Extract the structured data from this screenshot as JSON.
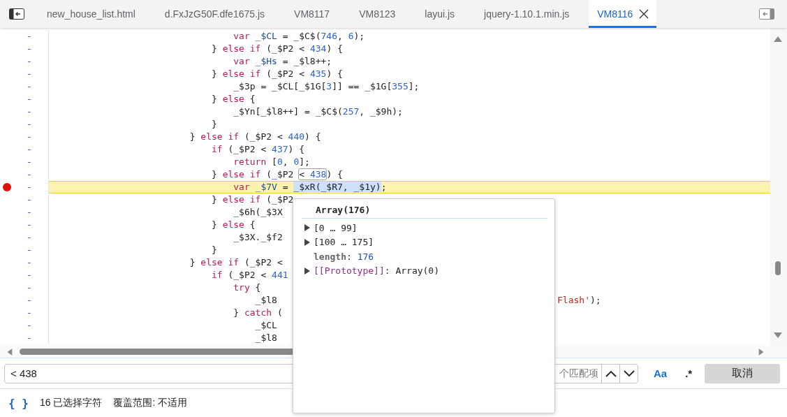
{
  "tabs": [
    {
      "label": "new_house_list.html",
      "selected": false
    },
    {
      "label": "d.FxJzG50F.dfe1675.js",
      "selected": false
    },
    {
      "label": "VM8117",
      "selected": false
    },
    {
      "label": "VM8123",
      "selected": false
    },
    {
      "label": "layui.js",
      "selected": false
    },
    {
      "label": "jquery-1.10.1.min.js",
      "selected": false
    },
    {
      "label": "VM8116",
      "selected": true
    }
  ],
  "lines": [
    {
      "gutter": "-",
      "breakpoint": false,
      "current": false,
      "tokens": [
        {
          "kind": "kw",
          "text": "                                 var"
        },
        {
          "kind": "def",
          "text": " _$CL"
        },
        {
          "kind": "plain",
          "text": " = _$C$("
        },
        {
          "kind": "num",
          "text": "746"
        },
        {
          "kind": "plain",
          "text": ", "
        },
        {
          "kind": "num",
          "text": "6"
        },
        {
          "kind": "plain",
          "text": ");"
        }
      ]
    },
    {
      "gutter": "-",
      "breakpoint": false,
      "current": false,
      "tokens": [
        {
          "kind": "plain",
          "text": "                             } "
        },
        {
          "kind": "kw",
          "text": "else if"
        },
        {
          "kind": "plain",
          "text": " (_$P2 < "
        },
        {
          "kind": "num",
          "text": "434"
        },
        {
          "kind": "plain",
          "text": ") {"
        }
      ]
    },
    {
      "gutter": "-",
      "breakpoint": false,
      "current": false,
      "tokens": [
        {
          "kind": "kw",
          "text": "                                 var"
        },
        {
          "kind": "def",
          "text": " _$Hs"
        },
        {
          "kind": "plain",
          "text": " = _$l8++;"
        }
      ]
    },
    {
      "gutter": "-",
      "breakpoint": false,
      "current": false,
      "tokens": [
        {
          "kind": "plain",
          "text": "                             } "
        },
        {
          "kind": "kw",
          "text": "else if"
        },
        {
          "kind": "plain",
          "text": " (_$P2 < "
        },
        {
          "kind": "num",
          "text": "435"
        },
        {
          "kind": "plain",
          "text": ") {"
        }
      ]
    },
    {
      "gutter": "-",
      "breakpoint": false,
      "current": false,
      "tokens": [
        {
          "kind": "plain",
          "text": "                                 _$3p = _$CL[_$1G["
        },
        {
          "kind": "num",
          "text": "3"
        },
        {
          "kind": "plain",
          "text": "]] == _$1G["
        },
        {
          "kind": "num",
          "text": "355"
        },
        {
          "kind": "plain",
          "text": "];"
        }
      ]
    },
    {
      "gutter": "-",
      "breakpoint": false,
      "current": false,
      "tokens": [
        {
          "kind": "plain",
          "text": "                             } "
        },
        {
          "kind": "kw",
          "text": "else"
        },
        {
          "kind": "plain",
          "text": " {"
        }
      ]
    },
    {
      "gutter": "-",
      "breakpoint": false,
      "current": false,
      "tokens": [
        {
          "kind": "plain",
          "text": "                                 _$Yn[_$l8++] = _$C$("
        },
        {
          "kind": "num",
          "text": "257"
        },
        {
          "kind": "plain",
          "text": ", _$9h);"
        }
      ]
    },
    {
      "gutter": "-",
      "breakpoint": false,
      "current": false,
      "tokens": [
        {
          "kind": "plain",
          "text": "                             }"
        }
      ]
    },
    {
      "gutter": "-",
      "breakpoint": false,
      "current": false,
      "tokens": [
        {
          "kind": "plain",
          "text": "                         } "
        },
        {
          "kind": "kw",
          "text": "else if"
        },
        {
          "kind": "plain",
          "text": " (_$P2 < "
        },
        {
          "kind": "num",
          "text": "440"
        },
        {
          "kind": "plain",
          "text": ") {"
        }
      ]
    },
    {
      "gutter": "-",
      "breakpoint": false,
      "current": false,
      "tokens": [
        {
          "kind": "kw",
          "text": "                             if"
        },
        {
          "kind": "plain",
          "text": " (_$P2 < "
        },
        {
          "kind": "num",
          "text": "437"
        },
        {
          "kind": "plain",
          "text": ") {"
        }
      ]
    },
    {
      "gutter": "-",
      "breakpoint": false,
      "current": false,
      "tokens": [
        {
          "kind": "kw",
          "text": "                                 return"
        },
        {
          "kind": "plain",
          "text": " ["
        },
        {
          "kind": "num",
          "text": "0"
        },
        {
          "kind": "plain",
          "text": ", "
        },
        {
          "kind": "num",
          "text": "0"
        },
        {
          "kind": "plain",
          "text": "];"
        }
      ]
    },
    {
      "gutter": "-",
      "breakpoint": false,
      "current": false,
      "tokens": [
        {
          "kind": "plain",
          "text": "                             } "
        },
        {
          "kind": "kw",
          "text": "else if"
        },
        {
          "kind": "plain",
          "text": " (_$P2 "
        },
        {
          "kind": "match",
          "parts": [
            {
              "kind": "plain",
              "text": "< "
            },
            {
              "kind": "num",
              "text": "438"
            }
          ]
        },
        {
          "kind": "plain",
          "text": ") {"
        }
      ]
    },
    {
      "gutter": "-",
      "breakpoint": true,
      "current": true,
      "tokens": [
        {
          "kind": "kw",
          "text": "                                 var"
        },
        {
          "kind": "def",
          "text": " _$7V"
        },
        {
          "kind": "plain",
          "text": " = "
        },
        {
          "kind": "sel",
          "text": "_$xR(_$R7, _$1y)"
        },
        {
          "kind": "plain",
          "text": ";"
        }
      ]
    },
    {
      "gutter": "-",
      "breakpoint": false,
      "current": false,
      "tokens": [
        {
          "kind": "plain",
          "text": "                             } "
        },
        {
          "kind": "kw",
          "text": "else if"
        },
        {
          "kind": "plain",
          "text": " (_$P2"
        }
      ]
    },
    {
      "gutter": "-",
      "breakpoint": false,
      "current": false,
      "tokens": [
        {
          "kind": "plain",
          "text": "                                 _$6h(_$3X"
        }
      ]
    },
    {
      "gutter": "-",
      "breakpoint": false,
      "current": false,
      "tokens": [
        {
          "kind": "plain",
          "text": "                             } "
        },
        {
          "kind": "kw",
          "text": "else"
        },
        {
          "kind": "plain",
          "text": " {"
        }
      ]
    },
    {
      "gutter": "-",
      "breakpoint": false,
      "current": false,
      "tokens": [
        {
          "kind": "plain",
          "text": "                                 _$3X._$f2"
        }
      ]
    },
    {
      "gutter": "-",
      "breakpoint": false,
      "current": false,
      "tokens": [
        {
          "kind": "plain",
          "text": "                             }"
        }
      ]
    },
    {
      "gutter": "-",
      "breakpoint": false,
      "current": false,
      "tokens": [
        {
          "kind": "plain",
          "text": "                         } "
        },
        {
          "kind": "kw",
          "text": "else if"
        },
        {
          "kind": "plain",
          "text": " (_$P2 <"
        }
      ]
    },
    {
      "gutter": "-",
      "breakpoint": false,
      "current": false,
      "tokens": [
        {
          "kind": "kw",
          "text": "                             if"
        },
        {
          "kind": "plain",
          "text": " (_$P2 < "
        },
        {
          "kind": "num",
          "text": "441"
        }
      ]
    },
    {
      "gutter": "-",
      "breakpoint": false,
      "current": false,
      "tokens": [
        {
          "kind": "kw",
          "text": "                                 try"
        },
        {
          "kind": "plain",
          "text": " {"
        }
      ]
    },
    {
      "gutter": "-",
      "breakpoint": false,
      "current": false,
      "tokens": [
        {
          "kind": "plain",
          "text": "                                     _$l8"
        },
        {
          "kind": "tail",
          "parts": [
            {
              "kind": "str",
              "text": "Flash'"
            },
            {
              "kind": "plain",
              "text": ");"
            }
          ]
        }
      ]
    },
    {
      "gutter": "-",
      "breakpoint": false,
      "current": false,
      "tokens": [
        {
          "kind": "plain",
          "text": "                                 } "
        },
        {
          "kind": "kw",
          "text": "catch"
        },
        {
          "kind": "plain",
          "text": " ("
        }
      ]
    },
    {
      "gutter": "-",
      "breakpoint": false,
      "current": false,
      "tokens": [
        {
          "kind": "plain",
          "text": "                                     _$CL"
        }
      ]
    },
    {
      "gutter": "-",
      "breakpoint": false,
      "current": false,
      "tokens": [
        {
          "kind": "plain",
          "text": "                                     _$l8"
        }
      ]
    }
  ],
  "popover": {
    "title": "Array(176)",
    "items": [
      {
        "kind": "range",
        "expanded": false,
        "label": "[0 … 99]"
      },
      {
        "kind": "range",
        "expanded": false,
        "label": "[100 … 175]"
      },
      {
        "kind": "property",
        "key": "length",
        "separator": ":",
        "value": "176"
      },
      {
        "kind": "prototype",
        "expanded": false,
        "key": "[[Prototype]]",
        "separator": ":",
        "value": "Array(0)"
      }
    ]
  },
  "search": {
    "value": "< 438",
    "match_count": "个匹配项",
    "match_case": {
      "label": "Aa",
      "on": true
    },
    "regex": {
      "label": ".*",
      "on": false
    },
    "cancel": "取消"
  },
  "status_bar": {
    "pretty_print": "{ }",
    "selection": "16 已选择字符",
    "coverage": "覆盖范围: 不适用"
  }
}
